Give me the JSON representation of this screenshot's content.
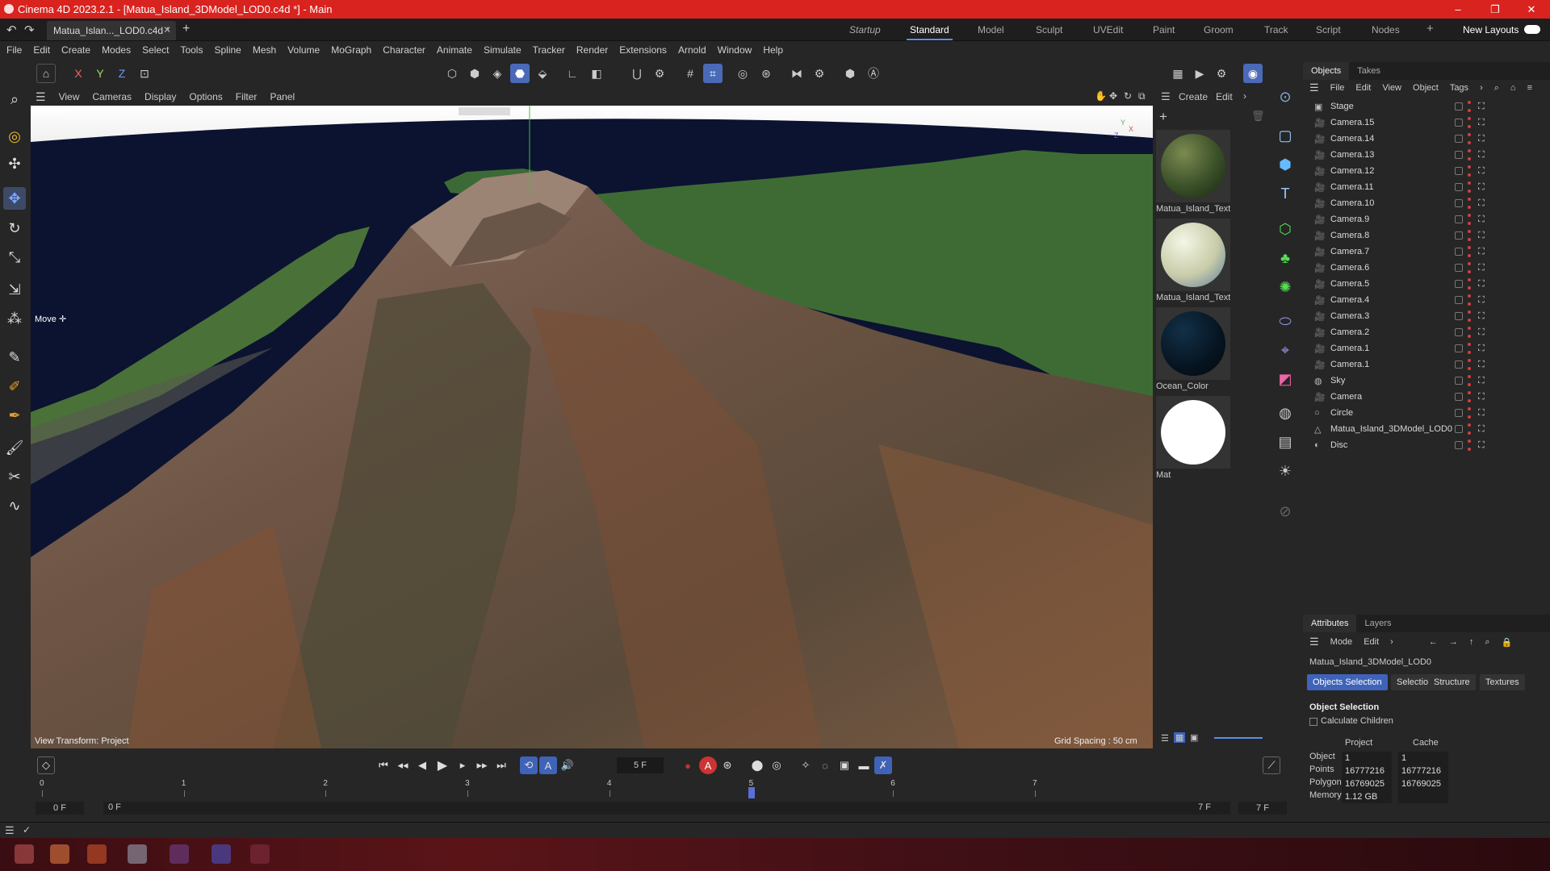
{
  "window": {
    "title": "Cinema 4D 2023.2.1 - [Matua_Island_3DModel_LOD0.c4d *] - Main",
    "controls": [
      "–",
      "❐",
      "✕"
    ]
  },
  "doc_tab": {
    "label": "Matua_Islan..._LOD0.c4d *",
    "close": "✕",
    "add": "+"
  },
  "layouts": [
    "Startup",
    "Standard",
    "Model",
    "Sculpt",
    "UVEdit",
    "Paint",
    "Groom",
    "Track",
    "Script",
    "Nodes"
  ],
  "layouts_add": "+",
  "new_layouts": "New Layouts",
  "menu": [
    "File",
    "Edit",
    "Create",
    "Modes",
    "Select",
    "Tools",
    "Spline",
    "Mesh",
    "Volume",
    "MoGraph",
    "Character",
    "Animate",
    "Simulate",
    "Tracker",
    "Render",
    "Extensions",
    "Arnold",
    "Window",
    "Help"
  ],
  "axis_buttons": [
    "X",
    "Y",
    "Z"
  ],
  "viewport": {
    "menu": [
      "View",
      "Cameras",
      "Display",
      "Options",
      "Filter",
      "Panel"
    ],
    "tool_label": "Move",
    "bottom_left": "View Transform: Project",
    "bottom_right": "Grid Spacing : 50 cm",
    "axes": {
      "x": "X",
      "y": "Y",
      "z": "Z"
    }
  },
  "materials": {
    "menu": [
      "Create",
      "Edit"
    ],
    "items": [
      {
        "name": "Matua_Island_Text",
        "color": "#3f5a30"
      },
      {
        "name": "Matua_Island_Text",
        "color": "#d8dcc0"
      },
      {
        "name": "Ocean_Color",
        "color": "#081828"
      },
      {
        "name": "Mat",
        "color": "#ffffff"
      }
    ]
  },
  "objects": {
    "tabs": [
      "Objects",
      "Takes"
    ],
    "menu": [
      "File",
      "Edit",
      "View",
      "Object",
      "Tags"
    ],
    "items": [
      {
        "name": "Stage",
        "icon": "▣"
      },
      {
        "name": "Camera.15",
        "icon": "🎥"
      },
      {
        "name": "Camera.14",
        "icon": "🎥"
      },
      {
        "name": "Camera.13",
        "icon": "🎥"
      },
      {
        "name": "Camera.12",
        "icon": "🎥"
      },
      {
        "name": "Camera.11",
        "icon": "🎥"
      },
      {
        "name": "Camera.10",
        "icon": "🎥"
      },
      {
        "name": "Camera.9",
        "icon": "🎥"
      },
      {
        "name": "Camera.8",
        "icon": "🎥"
      },
      {
        "name": "Camera.7",
        "icon": "🎥"
      },
      {
        "name": "Camera.6",
        "icon": "🎥"
      },
      {
        "name": "Camera.5",
        "icon": "🎥"
      },
      {
        "name": "Camera.4",
        "icon": "🎥"
      },
      {
        "name": "Camera.3",
        "icon": "🎥"
      },
      {
        "name": "Camera.2",
        "icon": "🎥"
      },
      {
        "name": "Camera.1",
        "icon": "🎥"
      },
      {
        "name": "Camera.1",
        "icon": "🎥"
      },
      {
        "name": "Sky",
        "icon": "◍"
      },
      {
        "name": "Camera",
        "icon": "🎥"
      },
      {
        "name": "Circle",
        "icon": "○"
      },
      {
        "name": "Matua_Island_3DModel_LOD0",
        "icon": "△"
      },
      {
        "name": "Disc",
        "icon": "◐"
      }
    ]
  },
  "attributes": {
    "tabs": [
      "Attributes",
      "Layers"
    ],
    "menu": [
      "Mode",
      "Edit"
    ],
    "object_name": "Matua_Island_3DModel_LOD0",
    "buttons": [
      "Objects Selection",
      "Selection",
      "Structure",
      "Textures"
    ],
    "section": "Object Selection",
    "calc_children": "Calculate Children",
    "col_project": "Project",
    "col_cache": "Cache",
    "rows": [
      {
        "label": "Object",
        "project": "1",
        "cache": "1"
      },
      {
        "label": "Points",
        "project": "16777216",
        "cache": "16777216"
      },
      {
        "label": "Polygons",
        "project": "16769025",
        "cache": "16769025"
      },
      {
        "label": "Memory",
        "project": "1.12 GB",
        "cache": ""
      }
    ]
  },
  "timeline": {
    "current_frame": "5 F",
    "ticks": [
      "0",
      "1",
      "2",
      "3",
      "4",
      "5",
      "6",
      "7"
    ],
    "start": "0 F",
    "range_start": "0 F",
    "range_end": "7 F",
    "end": "7 F",
    "playhead": 5,
    "max": 7
  }
}
